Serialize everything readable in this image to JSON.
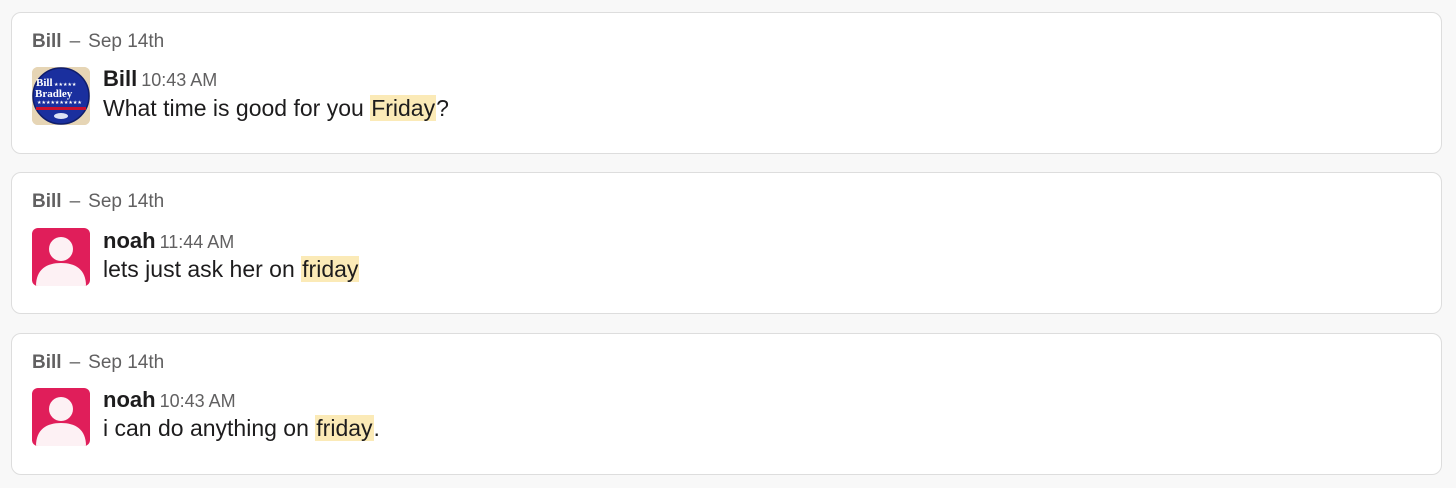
{
  "results": [
    {
      "channel": "Bill",
      "separator": "–",
      "date": "Sep 14th",
      "author": "Bill",
      "time": "10:43 AM",
      "text_before": "What time is good for you ",
      "highlight": "Friday",
      "text_after": "?",
      "avatar_text": "Bill Bradley"
    },
    {
      "channel": "Bill",
      "separator": "–",
      "date": "Sep 14th",
      "author": "noah",
      "time": "11:44 AM",
      "text_before": "lets just ask her on ",
      "highlight": "friday",
      "text_after": ""
    },
    {
      "channel": "Bill",
      "separator": "–",
      "date": "Sep 14th",
      "author": "noah",
      "time": "10:43 AM",
      "text_before": "i can do anything on ",
      "highlight": "friday",
      "text_after": "."
    }
  ],
  "colors": {
    "highlight": "#fbeab7",
    "default_avatar": "#e01e5a",
    "card_border": "#dddddd"
  },
  "icons": {
    "avatar_default": "user-silhouette-icon"
  }
}
